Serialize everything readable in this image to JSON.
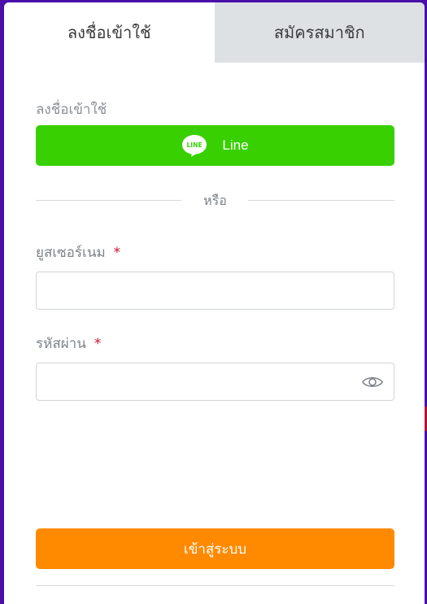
{
  "tabs": {
    "login": "ลงชื่อเข้าใช้",
    "register": "สมัครสมาชิก",
    "active": "login"
  },
  "login": {
    "section_label": "ลงชื่อเข้าใช้",
    "line_button_label": "Line",
    "line_logo_text": "LINE",
    "divider_text": "หรือ",
    "username_label": "ยูสเซอร์เนม",
    "username_value": "",
    "password_label": "รหัสผ่าน",
    "password_value": "",
    "required_marker": "*",
    "submit_label": "เข้าสู่ระบบ"
  },
  "colors": {
    "line_green": "#38d000",
    "submit_orange": "#ff8a00",
    "required_red": "#c8102e",
    "inactive_tab": "#dde1e4",
    "background": "#4a0fa8"
  },
  "icons": {
    "line": "line-logo-icon",
    "password_toggle": "eye-icon"
  }
}
